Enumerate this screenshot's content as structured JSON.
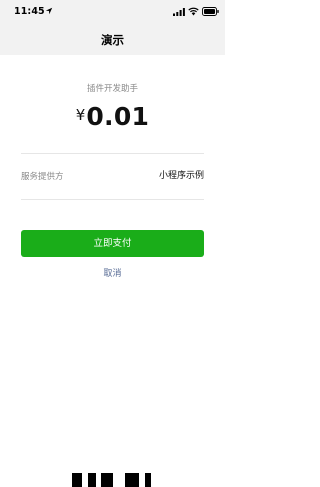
{
  "status_bar": {
    "time": "11:45",
    "icons": [
      "location-arrow-icon",
      "signal-icon",
      "wifi-icon",
      "battery-icon"
    ]
  },
  "nav": {
    "title": "演示"
  },
  "payment": {
    "merchant": "插件开发助手",
    "currency_symbol": "¥",
    "amount": "0.01"
  },
  "details": {
    "provider_label": "服务提供方",
    "provider_value": "小程序示例"
  },
  "actions": {
    "pay_label": "立即支付",
    "cancel_label": "取消"
  },
  "colors": {
    "header_background": "#f2f2f2",
    "pay_button": "#1aad19",
    "cancel_link": "#576b95",
    "muted_text": "#8a8a8a"
  }
}
